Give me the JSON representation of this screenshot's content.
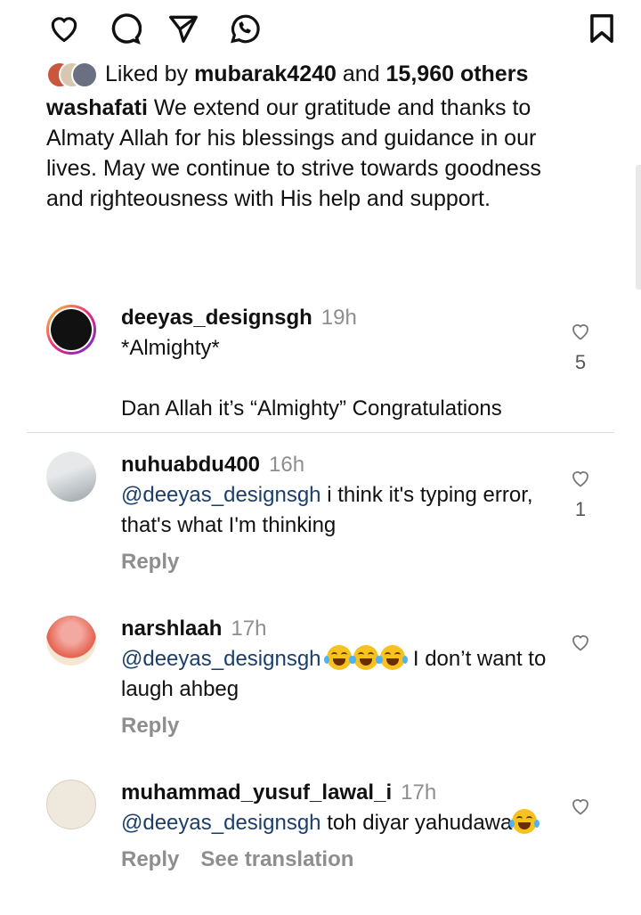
{
  "post": {
    "likes": {
      "prefix": "Liked by",
      "user": "mubarak4240",
      "and": "and",
      "others": "15,960 others"
    },
    "caption": {
      "user": "washafati",
      "text": "We extend our gratitude and thanks to Almaty Allah for his blessings and guidance in our lives. May we continue to strive towards goodness and righteousness with His help and support."
    }
  },
  "comments": [
    {
      "user": "deeyas_designsgh",
      "time": "19h",
      "line1": "*Almighty*",
      "line2": "Dan Allah it’s “Almighty” Congratulations",
      "likes": "5"
    },
    {
      "user": "nuhuabdu400",
      "time": "16h",
      "mention": "@deeyas_designsgh",
      "text": "i think it's typing error, that's what I'm thinking",
      "likes": "1",
      "reply": "Reply"
    },
    {
      "user": "narshlaah",
      "time": "17h",
      "mention": "@deeyas_designsgh",
      "text": "I don’t want to laugh ahbeg",
      "reply": "Reply"
    },
    {
      "user": "muhammad_yusuf_lawal_i",
      "time": "17h",
      "mention": "@deeyas_designsgh",
      "text": "toh diyar yahudawa",
      "reply": "Reply",
      "translate": "See translation"
    }
  ],
  "icons": [
    "heart-icon",
    "comment-icon",
    "share-icon",
    "whatsapp-icon",
    "bookmark-icon"
  ],
  "colors": {
    "mention": "#1b3f6b",
    "muted": "#8e8e8e",
    "divider": "#dbdbdb"
  }
}
